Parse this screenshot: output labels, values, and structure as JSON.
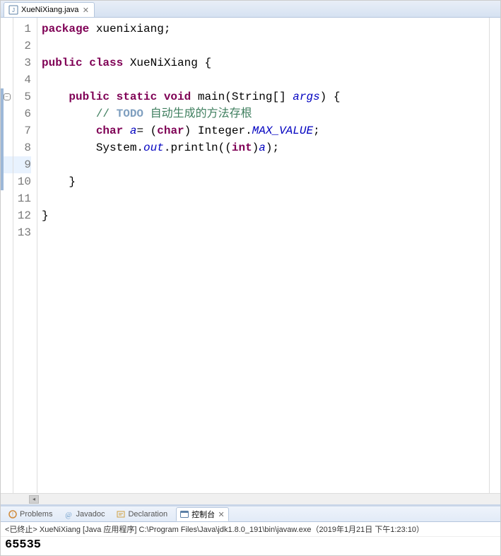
{
  "tab": {
    "filename": "XueNiXiang.java"
  },
  "code": {
    "lines": 13,
    "current_line": 9,
    "blue_bar_from": 5,
    "blue_bar_to": 10,
    "folding_at": 5,
    "tokens": [
      [
        {
          "t": "package ",
          "c": "kw"
        },
        {
          "t": "xuenixiang;",
          "c": ""
        }
      ],
      [],
      [
        {
          "t": "public class ",
          "c": "kw"
        },
        {
          "t": "XueNiXiang {",
          "c": ""
        }
      ],
      [],
      [
        {
          "t": "    ",
          "c": ""
        },
        {
          "t": "public static void ",
          "c": "kw"
        },
        {
          "t": "main(String[] ",
          "c": ""
        },
        {
          "t": "args",
          "c": "it"
        },
        {
          "t": ") {",
          "c": ""
        }
      ],
      [
        {
          "t": "        // ",
          "c": "cm"
        },
        {
          "t": "TODO",
          "c": "todo"
        },
        {
          "t": " 自动生成的方法存根",
          "c": "cm"
        }
      ],
      [
        {
          "t": "        ",
          "c": ""
        },
        {
          "t": "char ",
          "c": "kw"
        },
        {
          "t": "a",
          "c": "it"
        },
        {
          "t": "= (",
          "c": ""
        },
        {
          "t": "char",
          "c": "kw"
        },
        {
          "t": ") Integer.",
          "c": ""
        },
        {
          "t": "MAX_VALUE",
          "c": "sf"
        },
        {
          "t": ";",
          "c": ""
        }
      ],
      [
        {
          "t": "        System.",
          "c": ""
        },
        {
          "t": "out",
          "c": "sf"
        },
        {
          "t": ".println((",
          "c": ""
        },
        {
          "t": "int",
          "c": "kw"
        },
        {
          "t": ")",
          "c": ""
        },
        {
          "t": "a",
          "c": "it"
        },
        {
          "t": ");",
          "c": ""
        }
      ],
      [
        {
          "t": "        ",
          "c": ""
        }
      ],
      [
        {
          "t": "    }",
          "c": ""
        }
      ],
      [],
      [
        {
          "t": "}",
          "c": ""
        }
      ],
      []
    ]
  },
  "views": {
    "problems": {
      "label": "Problems"
    },
    "javadoc": {
      "label": "Javadoc"
    },
    "declaration": {
      "label": "Declaration"
    },
    "console": {
      "label": "控制台"
    }
  },
  "console": {
    "status": "<已终止> XueNiXiang [Java 应用程序] C:\\Program Files\\Java\\jdk1.8.0_191\\bin\\javaw.exe（2019年1月21日 下午1:23:10）",
    "output": "65535"
  }
}
